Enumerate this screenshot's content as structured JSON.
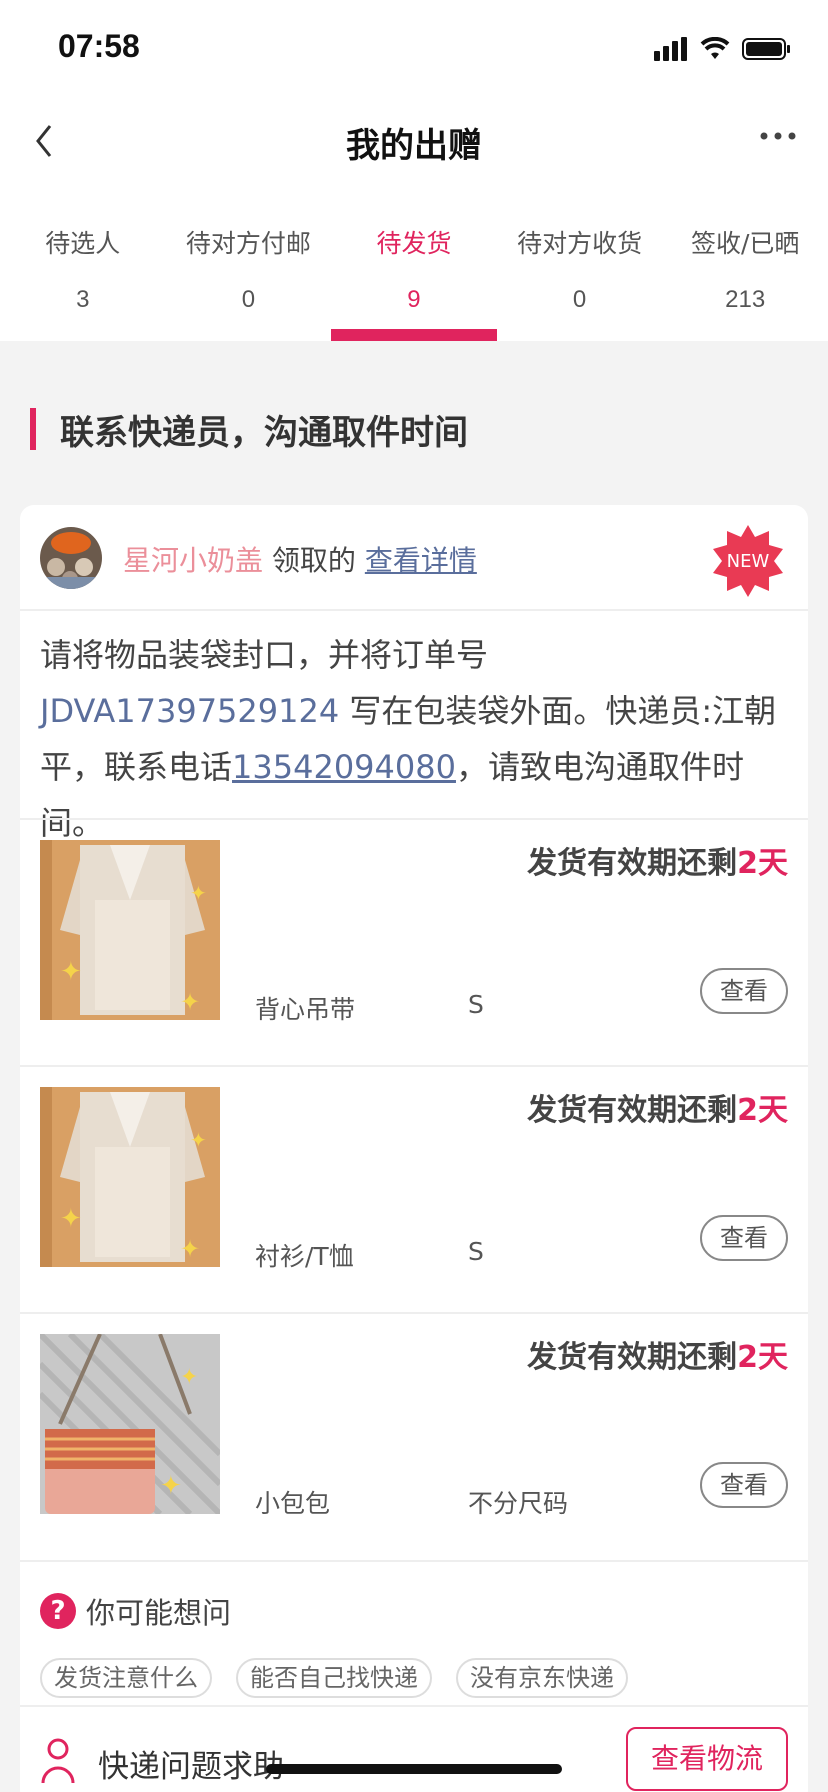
{
  "status_bar": {
    "time": "07:58"
  },
  "nav": {
    "title": "我的出赠"
  },
  "tabs": [
    {
      "label": "待选人",
      "count": "3",
      "active": false
    },
    {
      "label": "待对方付邮",
      "count": "0",
      "active": false
    },
    {
      "label": "待发货",
      "count": "9",
      "active": true
    },
    {
      "label": "待对方收货",
      "count": "0",
      "active": false
    },
    {
      "label": "签收/已晒",
      "count": "213",
      "active": false
    }
  ],
  "section": {
    "title": "联系快递员，沟通取件时间"
  },
  "card": {
    "giver_name": "星河小奶盖",
    "giver_action": "领取的",
    "detail_link": "查看详情",
    "badge": "NEW",
    "instruction": {
      "part1": "请将物品装袋封口，并将订单号 ",
      "order_no": "JDVA17397529124",
      "part2": " 写在包装袋外面。快递员:江朝平，联系电话",
      "phone": "13542094080",
      "part3": "，请致电沟通取件时间。"
    },
    "items": [
      {
        "deadline_prefix": "发货有效期还剩",
        "deadline_days": "2天",
        "category": "背心吊带",
        "size": "S",
        "button": "查看"
      },
      {
        "deadline_prefix": "发货有效期还剩",
        "deadline_days": "2天",
        "category": "衬衫/T恤",
        "size": "S",
        "button": "查看"
      },
      {
        "deadline_prefix": "发货有效期还剩",
        "deadline_days": "2天",
        "category": "小包包",
        "size": "不分尺码",
        "button": "查看"
      }
    ],
    "faq": {
      "title": "你可能想问",
      "chips": [
        "发货注意什么",
        "能否自己找快递",
        "没有京东快递"
      ]
    },
    "help": {
      "label": "快递问题求助",
      "button": "查看物流"
    }
  },
  "colors": {
    "accent": "#e0245e",
    "link": "#5a6e9c",
    "giver": "#eb8f9a"
  }
}
